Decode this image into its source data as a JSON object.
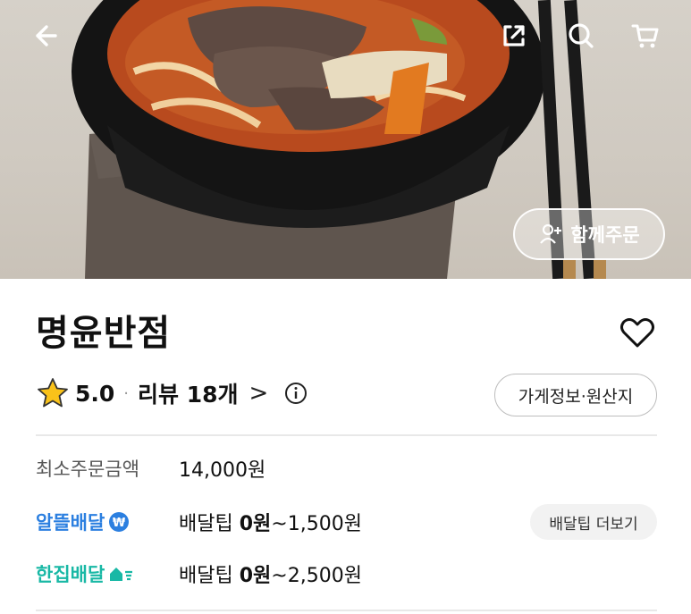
{
  "header": {
    "back_icon": "arrow-left-icon",
    "share_icon": "share-icon",
    "search_icon": "search-icon",
    "cart_icon": "cart-icon",
    "group_order_label": "함께주문",
    "group_order_icon": "add-person-icon"
  },
  "store": {
    "name": "명윤반점",
    "favorite_icon": "heart-icon",
    "rating": "5.0",
    "separator": "·",
    "review_label": "리뷰 18개",
    "review_chevron": ">",
    "info_icon": "info-icon",
    "info_button_label": "가게정보·원산지"
  },
  "order": {
    "min_order_label": "최소주문금액",
    "min_order_value": "14,000원"
  },
  "delivery": {
    "alttle_label": "알뜰배달",
    "alttle_tip_prefix": "배달팁 ",
    "alttle_tip_bold": "0원",
    "alttle_tip_suffix": "~1,500원",
    "more_tip_label": "배달팁 더보기",
    "hanjip_label": "한집배달",
    "hanjip_tip_prefix": "배달팁 ",
    "hanjip_tip_bold": "0원",
    "hanjip_tip_suffix": "~2,500원"
  },
  "colors": {
    "alttle": "#2b7fe0",
    "hanjip": "#18b8a5",
    "text": "#111111"
  }
}
